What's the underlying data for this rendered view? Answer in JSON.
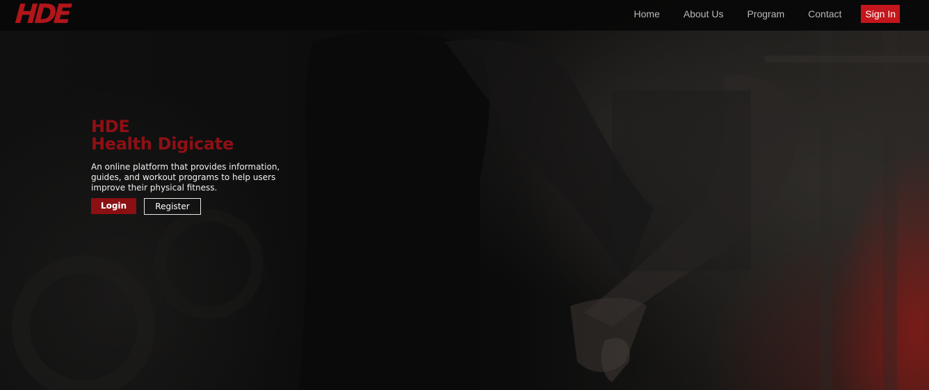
{
  "navbar": {
    "logo": "HDE",
    "links": [
      "Home",
      "About Us",
      "Program",
      "Contact"
    ],
    "signin_label": "Sign In"
  },
  "hero": {
    "title_line1": "HDE",
    "title_line2": "Health Digicate",
    "description": "An online platform that provides information, guides, and workout programs to help users improve their physical fitness.",
    "login_label": "Login",
    "register_label": "Register"
  },
  "colors": {
    "brand_red": "#c4161c",
    "dark_red": "#8a1013",
    "background": "#0c0c0c"
  }
}
